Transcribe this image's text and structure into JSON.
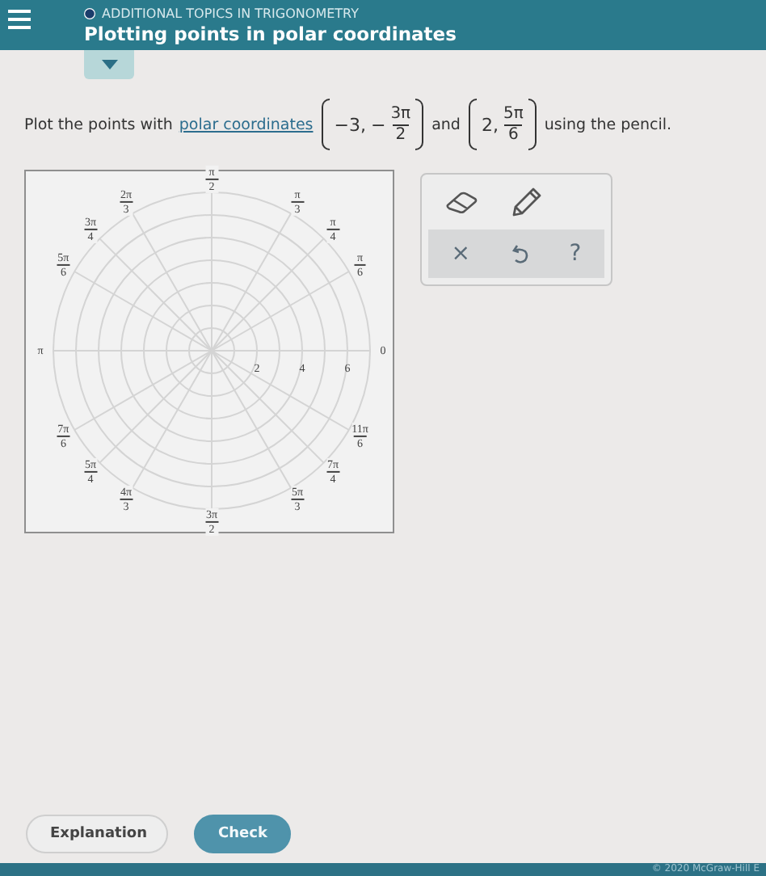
{
  "header": {
    "section": "ADDITIONAL TOPICS IN TRIGONOMETRY",
    "title": "Plotting points in polar coordinates"
  },
  "panel_toggle": {
    "expanded": false
  },
  "question": {
    "before": "Plot the points with",
    "link": "polar coordinates",
    "joiner": "and",
    "after": "using the pencil.",
    "points": [
      {
        "coordinate": "−3,",
        "sign": "−",
        "num": "3π",
        "den": "2"
      },
      {
        "coordinate": "2,",
        "num": "5π",
        "den": "6"
      }
    ]
  },
  "graph": {
    "angle_labels": [
      {
        "num": "0"
      },
      {
        "num": "π",
        "den": "6"
      },
      {
        "num": "π",
        "den": "4"
      },
      {
        "num": "π",
        "den": "3"
      },
      {
        "num": "π",
        "den": "2"
      },
      {
        "num": "2π",
        "den": "3"
      },
      {
        "num": "3π",
        "den": "4"
      },
      {
        "num": "5π",
        "den": "6"
      },
      {
        "num": "π"
      },
      {
        "num": "7π",
        "den": "6"
      },
      {
        "num": "5π",
        "den": "4"
      },
      {
        "num": "4π",
        "den": "3"
      },
      {
        "num": "3π",
        "den": "2"
      },
      {
        "num": "5π",
        "den": "3"
      },
      {
        "num": "7π",
        "den": "4"
      },
      {
        "num": "11π",
        "den": "6"
      }
    ],
    "radius_labels": [
      "2",
      "4",
      "6"
    ]
  },
  "tools": {
    "clear": "×",
    "help": "?"
  },
  "buttons": [
    {
      "label": "Explanation",
      "kind": "secondary"
    },
    {
      "label": "Check",
      "kind": "primary"
    }
  ],
  "footer": {
    "copyright": "© 2020 McGraw-Hill E"
  }
}
